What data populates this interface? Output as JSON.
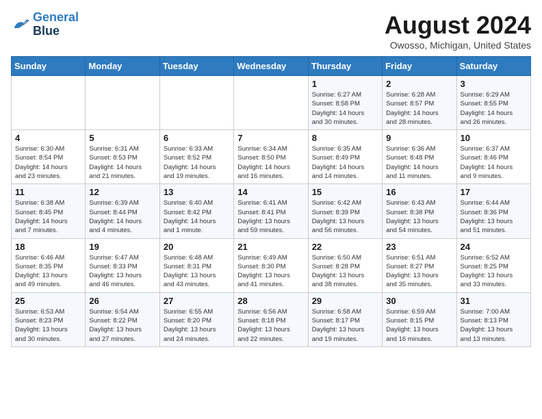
{
  "logo": {
    "line1": "General",
    "line2": "Blue"
  },
  "title": "August 2024",
  "location": "Owosso, Michigan, United States",
  "days_of_week": [
    "Sunday",
    "Monday",
    "Tuesday",
    "Wednesday",
    "Thursday",
    "Friday",
    "Saturday"
  ],
  "weeks": [
    [
      {
        "day": "",
        "info": ""
      },
      {
        "day": "",
        "info": ""
      },
      {
        "day": "",
        "info": ""
      },
      {
        "day": "",
        "info": ""
      },
      {
        "day": "1",
        "info": "Sunrise: 6:27 AM\nSunset: 8:58 PM\nDaylight: 14 hours\nand 30 minutes."
      },
      {
        "day": "2",
        "info": "Sunrise: 6:28 AM\nSunset: 8:57 PM\nDaylight: 14 hours\nand 28 minutes."
      },
      {
        "day": "3",
        "info": "Sunrise: 6:29 AM\nSunset: 8:55 PM\nDaylight: 14 hours\nand 26 minutes."
      }
    ],
    [
      {
        "day": "4",
        "info": "Sunrise: 6:30 AM\nSunset: 8:54 PM\nDaylight: 14 hours\nand 23 minutes."
      },
      {
        "day": "5",
        "info": "Sunrise: 6:31 AM\nSunset: 8:53 PM\nDaylight: 14 hours\nand 21 minutes."
      },
      {
        "day": "6",
        "info": "Sunrise: 6:33 AM\nSunset: 8:52 PM\nDaylight: 14 hours\nand 19 minutes."
      },
      {
        "day": "7",
        "info": "Sunrise: 6:34 AM\nSunset: 8:50 PM\nDaylight: 14 hours\nand 16 minutes."
      },
      {
        "day": "8",
        "info": "Sunrise: 6:35 AM\nSunset: 8:49 PM\nDaylight: 14 hours\nand 14 minutes."
      },
      {
        "day": "9",
        "info": "Sunrise: 6:36 AM\nSunset: 8:48 PM\nDaylight: 14 hours\nand 11 minutes."
      },
      {
        "day": "10",
        "info": "Sunrise: 6:37 AM\nSunset: 8:46 PM\nDaylight: 14 hours\nand 9 minutes."
      }
    ],
    [
      {
        "day": "11",
        "info": "Sunrise: 6:38 AM\nSunset: 8:45 PM\nDaylight: 14 hours\nand 7 minutes."
      },
      {
        "day": "12",
        "info": "Sunrise: 6:39 AM\nSunset: 8:44 PM\nDaylight: 14 hours\nand 4 minutes."
      },
      {
        "day": "13",
        "info": "Sunrise: 6:40 AM\nSunset: 8:42 PM\nDaylight: 14 hours\nand 1 minute."
      },
      {
        "day": "14",
        "info": "Sunrise: 6:41 AM\nSunset: 8:41 PM\nDaylight: 13 hours\nand 59 minutes."
      },
      {
        "day": "15",
        "info": "Sunrise: 6:42 AM\nSunset: 8:39 PM\nDaylight: 13 hours\nand 56 minutes."
      },
      {
        "day": "16",
        "info": "Sunrise: 6:43 AM\nSunset: 8:38 PM\nDaylight: 13 hours\nand 54 minutes."
      },
      {
        "day": "17",
        "info": "Sunrise: 6:44 AM\nSunset: 8:36 PM\nDaylight: 13 hours\nand 51 minutes."
      }
    ],
    [
      {
        "day": "18",
        "info": "Sunrise: 6:46 AM\nSunset: 8:35 PM\nDaylight: 13 hours\nand 49 minutes."
      },
      {
        "day": "19",
        "info": "Sunrise: 6:47 AM\nSunset: 8:33 PM\nDaylight: 13 hours\nand 46 minutes."
      },
      {
        "day": "20",
        "info": "Sunrise: 6:48 AM\nSunset: 8:31 PM\nDaylight: 13 hours\nand 43 minutes."
      },
      {
        "day": "21",
        "info": "Sunrise: 6:49 AM\nSunset: 8:30 PM\nDaylight: 13 hours\nand 41 minutes."
      },
      {
        "day": "22",
        "info": "Sunrise: 6:50 AM\nSunset: 8:28 PM\nDaylight: 13 hours\nand 38 minutes."
      },
      {
        "day": "23",
        "info": "Sunrise: 6:51 AM\nSunset: 8:27 PM\nDaylight: 13 hours\nand 35 minutes."
      },
      {
        "day": "24",
        "info": "Sunrise: 6:52 AM\nSunset: 8:25 PM\nDaylight: 13 hours\nand 33 minutes."
      }
    ],
    [
      {
        "day": "25",
        "info": "Sunrise: 6:53 AM\nSunset: 8:23 PM\nDaylight: 13 hours\nand 30 minutes."
      },
      {
        "day": "26",
        "info": "Sunrise: 6:54 AM\nSunset: 8:22 PM\nDaylight: 13 hours\nand 27 minutes."
      },
      {
        "day": "27",
        "info": "Sunrise: 6:55 AM\nSunset: 8:20 PM\nDaylight: 13 hours\nand 24 minutes."
      },
      {
        "day": "28",
        "info": "Sunrise: 6:56 AM\nSunset: 8:18 PM\nDaylight: 13 hours\nand 22 minutes."
      },
      {
        "day": "29",
        "info": "Sunrise: 6:58 AM\nSunset: 8:17 PM\nDaylight: 13 hours\nand 19 minutes."
      },
      {
        "day": "30",
        "info": "Sunrise: 6:59 AM\nSunset: 8:15 PM\nDaylight: 13 hours\nand 16 minutes."
      },
      {
        "day": "31",
        "info": "Sunrise: 7:00 AM\nSunset: 8:13 PM\nDaylight: 13 hours\nand 13 minutes."
      }
    ]
  ]
}
